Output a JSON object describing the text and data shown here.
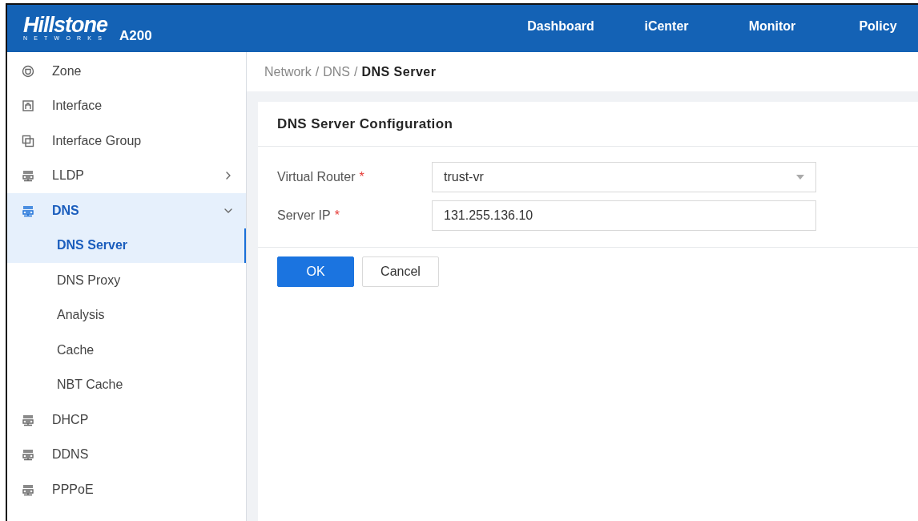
{
  "header": {
    "logo": {
      "name": "Hillstone",
      "tagline": "NETWORKS",
      "model": "A200"
    },
    "nav": [
      {
        "label": "Dashboard",
        "selected": false
      },
      {
        "label": "iCenter",
        "selected": false
      },
      {
        "label": "Monitor",
        "selected": false
      },
      {
        "label": "Policy",
        "selected": false
      }
    ]
  },
  "sidebar": {
    "items": [
      {
        "label": "Zone",
        "selected": false
      },
      {
        "label": "Interface",
        "selected": false
      },
      {
        "label": "Interface Group",
        "selected": false
      },
      {
        "label": "LLDP",
        "selected": false,
        "expanded": false
      },
      {
        "label": "DNS",
        "selected": true,
        "expanded": true,
        "children": [
          {
            "label": "DNS Server",
            "selected": true
          },
          {
            "label": "DNS Proxy",
            "selected": false
          },
          {
            "label": "Analysis",
            "selected": false
          },
          {
            "label": "Cache",
            "selected": false
          },
          {
            "label": "NBT Cache",
            "selected": false
          }
        ]
      },
      {
        "label": "DHCP",
        "selected": false
      },
      {
        "label": "DDNS",
        "selected": false
      },
      {
        "label": "PPPoE",
        "selected": false
      }
    ]
  },
  "breadcrumb": [
    {
      "kind": "link",
      "text": "Network"
    },
    {
      "kind": "separator",
      "text": "/"
    },
    {
      "kind": "link",
      "text": "DNS"
    },
    {
      "kind": "separator",
      "text": "/"
    },
    {
      "kind": "current",
      "text": "DNS Server"
    }
  ],
  "form": {
    "title": "DNS Server Configuration",
    "fields": [
      {
        "kind": "select",
        "label": "Virtual Router",
        "required_mark": "*",
        "value": "trust-vr"
      },
      {
        "kind": "text",
        "label": "Server IP",
        "required_mark": "*",
        "value": "131.255.136.10"
      }
    ],
    "buttons": [
      {
        "label": "OK",
        "kind": "primary"
      },
      {
        "label": "Cancel",
        "kind": "secondary"
      }
    ]
  }
}
